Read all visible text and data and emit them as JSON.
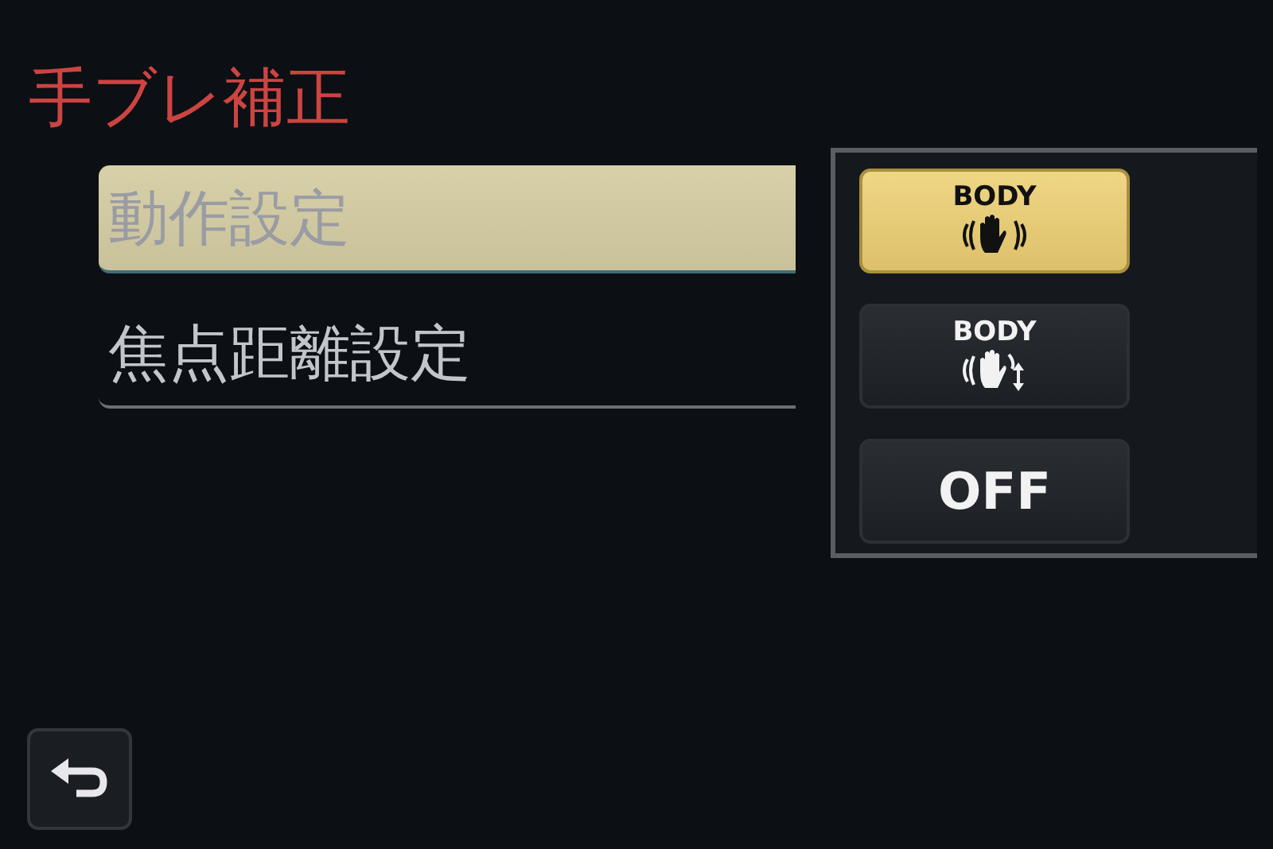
{
  "title": "手ブレ補正",
  "menu_items": [
    {
      "label": "動作設定",
      "selected": true
    },
    {
      "label": "焦点距離設定",
      "selected": false
    }
  ],
  "options_popup": [
    {
      "kind": "shake-all",
      "label": "BODY",
      "selected": true
    },
    {
      "kind": "shake-vertical",
      "label": "BODY",
      "selected": false
    },
    {
      "kind": "text",
      "label": "OFF",
      "selected": false
    }
  ],
  "back_button": {
    "kind": "return"
  }
}
